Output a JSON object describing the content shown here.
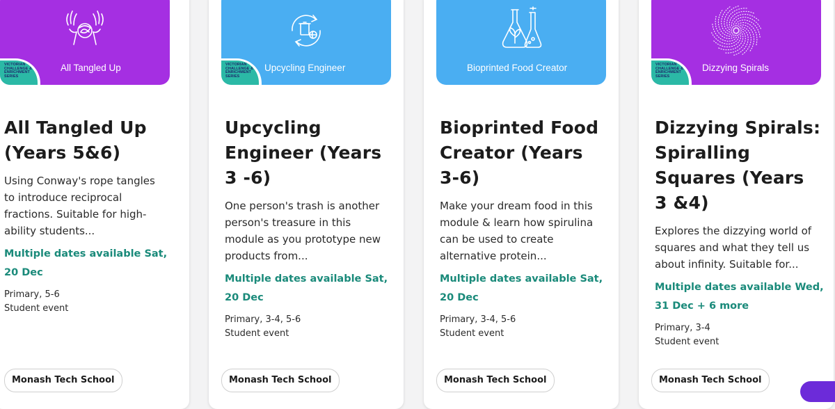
{
  "cards": [
    {
      "banner_title": "All Tangled Up",
      "banner_color": "#a52fe2",
      "icon": "hands-tangle-icon",
      "show_badge": true,
      "title": "All Tangled Up (Years 5&6)",
      "description": "Using Conway's rope tangles to introduce reciprocal fractions. Suitable for high-ability students...",
      "dates": "Multiple dates available Sat, 20 Dec",
      "levels": "Primary, 5-6",
      "event_type": "Student event",
      "organiser": "Monash Tech School"
    },
    {
      "banner_title": "Upcycling Engineer",
      "banner_color": "#4aaef2",
      "icon": "recycle-bin-globe-icon",
      "show_badge": true,
      "title": "Upcycling Engineer (Years 3 -6)",
      "description": "One person's trash is another person's treasure in this module as you prototype new products from...",
      "dates": "Multiple dates available Sat, 20 Dec",
      "levels": "Primary, 3-4, 5-6",
      "event_type": "Student event",
      "organiser": "Monash Tech School"
    },
    {
      "banner_title": "Bioprinted Food Creator",
      "banner_color": "#4aaef2",
      "icon": "flask-plant-icon",
      "show_badge": false,
      "title": "Bioprinted Food Creator (Years 3-6)",
      "description": "Make your dream food in this module & learn how spirulina can be used to create alternative protein...",
      "dates": "Multiple dates available Sat, 20 Dec",
      "levels": "Primary, 3-4, 5-6",
      "event_type": "Student event",
      "organiser": "Monash Tech School"
    },
    {
      "banner_title": "Dizzying Spirals",
      "banner_color": "#a52fe2",
      "icon": "spiral-icon",
      "show_badge": true,
      "title": "Dizzying Spirals: Spiralling Squares (Years 3 &4)",
      "description": "Explores the dizzying world of squares and what they tell us about infinity. Suitable for...",
      "dates": "Multiple dates available Wed, 31 Dec + 6 more",
      "levels": "Primary, 3-4",
      "event_type": "Student event",
      "organiser": "Monash Tech School"
    }
  ],
  "badge_text": "VICTORIAN CHALLENGE & ENRICHMENT SERIES"
}
